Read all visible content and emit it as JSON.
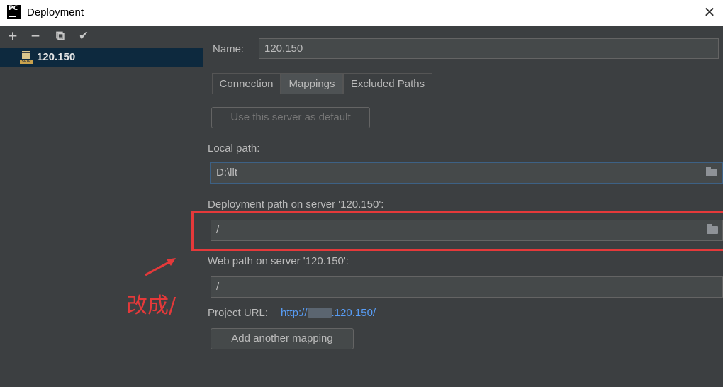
{
  "window": {
    "title": "Deployment",
    "app_icon_text": "PC",
    "close_glyph": "✕"
  },
  "toolbar": {
    "add_glyph": "+",
    "remove_glyph": "−",
    "copy_glyph": "⧉",
    "check_glyph": "✔"
  },
  "servers": [
    {
      "label": "120.150",
      "icon_text": "SFTP"
    }
  ],
  "form": {
    "name_label": "Name:",
    "name_value": "120.150"
  },
  "tabs": [
    {
      "label": "Connection"
    },
    {
      "label": "Mappings"
    },
    {
      "label": "Excluded Paths"
    }
  ],
  "mappings": {
    "use_default_button": "Use this server as default",
    "local_path_label": "Local path:",
    "local_path_value": "D:\\llt",
    "deployment_path_label": "Deployment path on server '120.150':",
    "deployment_path_value": "/",
    "web_path_label": "Web path on server '120.150':",
    "web_path_value": "/",
    "project_url_label": "Project URL:",
    "project_url_prefix": "http://",
    "project_url_suffix": ".120.150/",
    "add_mapping_button": "Add another mapping"
  },
  "annotation": {
    "text": "改成/",
    "color": "#e5393a"
  },
  "colors": {
    "background": "#3c3f41",
    "selection": "#0d293e",
    "link": "#589df6",
    "focus_border": "#3d6185"
  }
}
